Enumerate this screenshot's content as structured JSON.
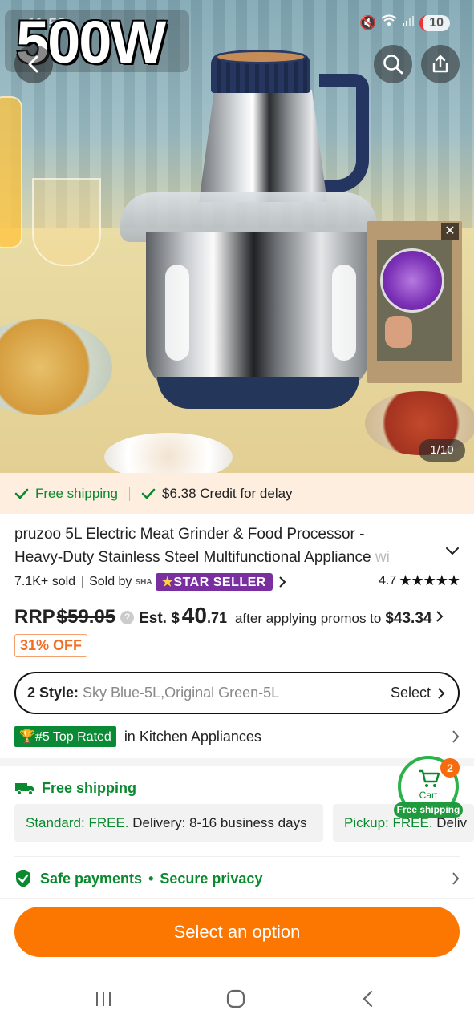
{
  "status_bar": {
    "time": "11:52",
    "battery": "10"
  },
  "hero": {
    "overlay_text": "500W",
    "image_counter": "1/10"
  },
  "shipping_banner": {
    "free_shipping": "Free shipping",
    "credit": "$6.38 Credit for delay"
  },
  "product": {
    "title_line1": "pruzoo 5L Electric Meat Grinder & Food Processor -",
    "title_line2": "Heavy-Duty Stainless Steel Multifunctional Appliance",
    "title_fade": " wi",
    "sold": "7.1K+ sold",
    "sold_by": "Sold by",
    "shop_logo": "SHA",
    "star_seller": "STAR  SELLER",
    "rating": "4.7",
    "stars": "★★★★★"
  },
  "price": {
    "rrp_label": "RRP",
    "rrp": "$59.05",
    "est_label": "Est. $",
    "est_whole": "40",
    "est_cents": ".71",
    "after_text": "after applying promos to",
    "final": "$43.34",
    "discount": "31% OFF"
  },
  "style_selector": {
    "label": "2 Style:",
    "value": "Sky Blue-5L,Original Green-5L",
    "action": "Select"
  },
  "ranking": {
    "badge": "#5 Top Rated",
    "text": "in Kitchen Appliances"
  },
  "delivery": {
    "title": "Free shipping",
    "standard_label": "Standard: FREE.",
    "standard_detail": " Delivery: 8-16 business days",
    "pickup_label": "Pickup: FREE.",
    "pickup_detail": " Deliv"
  },
  "cart": {
    "label": "Cart",
    "count": "2",
    "badge": "Free shipping"
  },
  "safety": {
    "payments": "Safe payments",
    "dot": "•",
    "privacy": "Secure privacy"
  },
  "cta": {
    "label": "Select an option"
  },
  "colors": {
    "accent": "#fb7701",
    "green": "#0a8a2e",
    "star_seller": "#7a2fa0",
    "discount": "#f06d22"
  }
}
